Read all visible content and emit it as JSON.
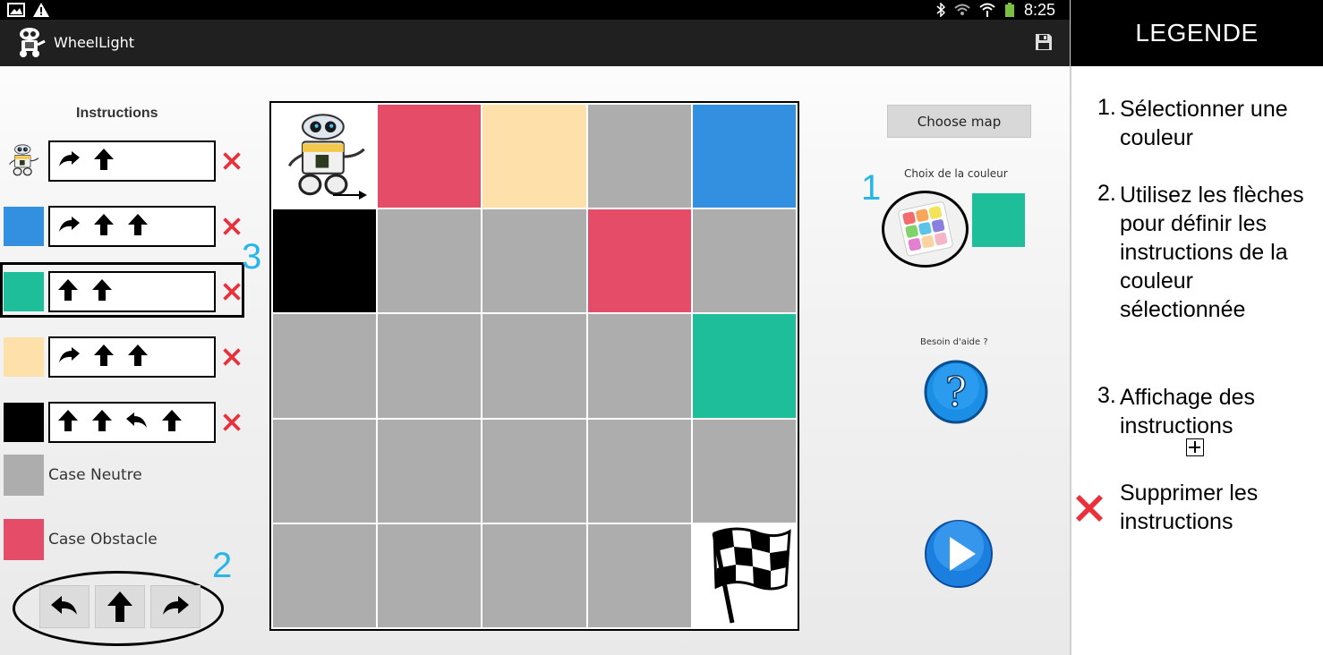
{
  "status_bar": {
    "time": "8:25"
  },
  "app": {
    "title": "WheelLight"
  },
  "left_panel": {
    "title": "Instructions",
    "rows": [
      {
        "id": "robot",
        "color": "robot",
        "moves": [
          "right",
          "up"
        ]
      },
      {
        "id": "blue",
        "color": "#338fe0",
        "moves": [
          "right",
          "up",
          "up"
        ]
      },
      {
        "id": "green",
        "color": "#1fbe9a",
        "moves": [
          "up",
          "up"
        ],
        "selected": true
      },
      {
        "id": "cream",
        "color": "#fde0aa",
        "moves": [
          "right",
          "up",
          "up"
        ]
      },
      {
        "id": "black",
        "color": "#000000",
        "moves": [
          "up",
          "up",
          "left",
          "up"
        ]
      }
    ],
    "legend": [
      {
        "label": "Case Neutre",
        "color": "#adadad"
      },
      {
        "label": "Case Obstacle",
        "color": "#e44c68"
      }
    ],
    "arrow_buttons": [
      "left",
      "up",
      "right"
    ]
  },
  "grid": {
    "rows": 5,
    "cols": 5,
    "cells": [
      "robot",
      "#e44c68",
      "#fde0aa",
      "#adadad",
      "#338fe0",
      "#000000",
      "#adadad",
      "#adadad",
      "#e44c68",
      "#adadad",
      "#adadad",
      "#adadad",
      "#adadad",
      "#adadad",
      "#1fbe9a",
      "#adadad",
      "#adadad",
      "#adadad",
      "#adadad",
      "#adadad",
      "#adadad",
      "#adadad",
      "#adadad",
      "#adadad",
      "flag"
    ]
  },
  "right_panel": {
    "choose_map_label": "Choose map",
    "color_choice_label": "Choix de la couleur",
    "selected_color": "#1fbe9a",
    "help_label": "Besoin d'aide ?"
  },
  "annotations": {
    "n1": "1",
    "n2": "2",
    "n3": "3"
  },
  "legend_panel": {
    "title": "LEGENDE",
    "items": [
      {
        "num": "1.",
        "text": "Sélectionner une couleur"
      },
      {
        "num": "2.",
        "text": "Utilisez les flèches pour définir les instructions de la couleur sélectionnée"
      },
      {
        "num": "3.",
        "text": "Affichage des instructions"
      }
    ],
    "delete_text": "Supprimer les instructions"
  }
}
